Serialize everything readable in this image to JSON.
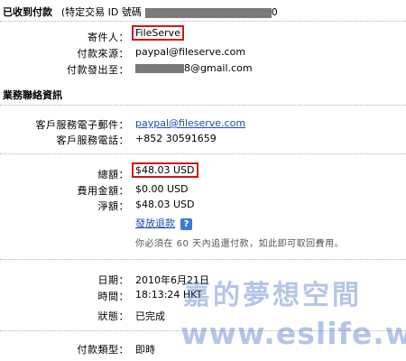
{
  "header": {
    "title": "已收到付款",
    "txn_prefix": "(特定交易 ID 號碼",
    "txn_suffix": "0"
  },
  "sender": {
    "name_label": "寄件人：",
    "name_value": "FileServe",
    "source_label": "付款來源：",
    "source_value": "paypal@fileserve.com",
    "sent_to_label": "付款發出至：",
    "sent_to_suffix": "8@gmail.com"
  },
  "business": {
    "section_title": "業務聯絡資訊",
    "email_label": "客戶服務電子郵件：",
    "email_value": "paypal@fileserve.com",
    "phone_label": "客戶服務電話：",
    "phone_value": "+852 30591659"
  },
  "amounts": {
    "total_label": "總額：",
    "total_value": "$48.03 USD",
    "fee_label": "費用金額：",
    "fee_value": "$0.00 USD",
    "net_label": "淨額：",
    "net_value": "$48.03 USD",
    "refund_link": "發放退款",
    "help_icon": "?",
    "refund_note": "你必須在 60 天內追還付款，如此即可取回費用。"
  },
  "details": {
    "date_label": "日期：",
    "date_value": "2010年6月21日",
    "time_label": "時間：",
    "time_value": "18:13:24 HKT",
    "status_label": "狀態：",
    "status_value": "已完成",
    "type_label": "付款類型：",
    "type_value": "即時"
  },
  "watermark": {
    "line1": "嘉的夢想空間",
    "line2": "www.eslife.ws"
  },
  "colors": {
    "highlight_box": "#d4141c",
    "link": "#1a4db8",
    "watermark": "#466ec8"
  }
}
